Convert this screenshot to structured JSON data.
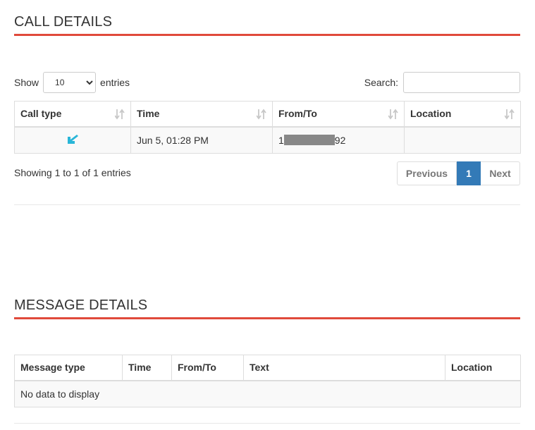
{
  "call_section": {
    "title": "CALL DETAILS",
    "show_label": "Show",
    "entries_label": "entries",
    "length_value": "10",
    "search_label": "Search:",
    "search_value": "",
    "columns": [
      "Call type",
      "Time",
      "From/To",
      "Location"
    ],
    "rows": [
      {
        "call_type_icon": "incoming-call-arrow-icon",
        "time": "Jun 5, 01:28 PM",
        "from_to_prefix": "1",
        "from_to_suffix": "92",
        "location": ""
      }
    ],
    "info": "Showing 1 to 1 of 1 entries",
    "pagination": {
      "previous": "Previous",
      "current": "1",
      "next": "Next"
    }
  },
  "message_section": {
    "title": "MESSAGE DETAILS",
    "columns": [
      "Message type",
      "Time",
      "From/To",
      "Text",
      "Location"
    ],
    "empty_text": "No data to display"
  },
  "colors": {
    "title_rule": "#e04a3b",
    "active_page": "#337ab7",
    "call_icon": "#29b6d8",
    "redaction": "#888888"
  }
}
